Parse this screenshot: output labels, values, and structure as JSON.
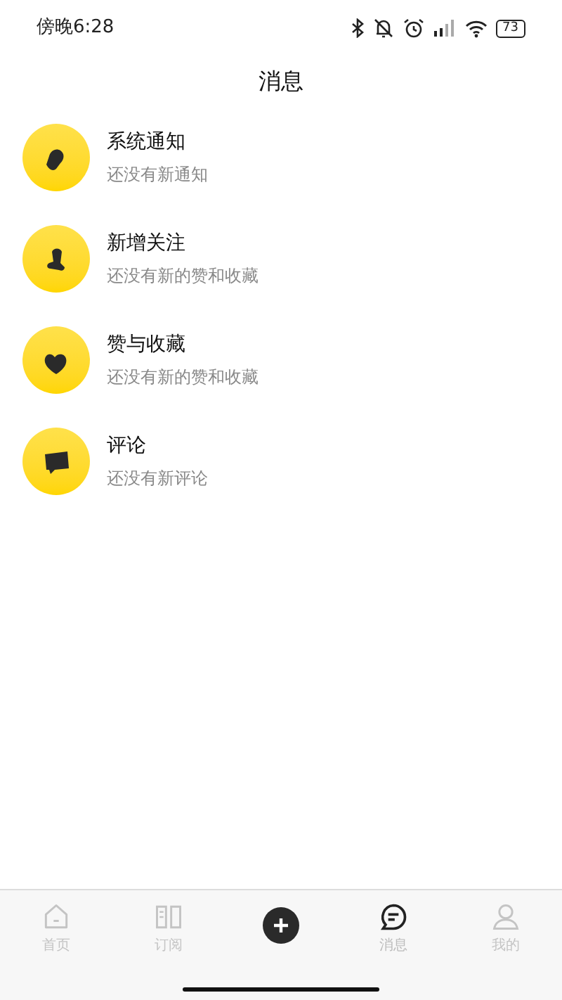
{
  "status_bar": {
    "time": "傍晚6:28",
    "battery": "73"
  },
  "header": {
    "title": "消息"
  },
  "messages": [
    {
      "kind": "bell",
      "title": "系统通知",
      "subtitle": "还没有新通知"
    },
    {
      "kind": "person",
      "title": "新增关注",
      "subtitle": "还没有新的赞和收藏"
    },
    {
      "kind": "heart",
      "title": "赞与收藏",
      "subtitle": "还没有新的赞和收藏"
    },
    {
      "kind": "comment",
      "title": "评论",
      "subtitle": "还没有新评论"
    }
  ],
  "tab_bar": [
    {
      "kind": "home",
      "label": "首页",
      "selected": false
    },
    {
      "kind": "book",
      "label": "订阅",
      "selected": false
    },
    {
      "kind": "add",
      "selected": false
    },
    {
      "kind": "chat",
      "label": "消息",
      "selected": true
    },
    {
      "kind": "user",
      "label": "我的",
      "selected": false
    }
  ]
}
